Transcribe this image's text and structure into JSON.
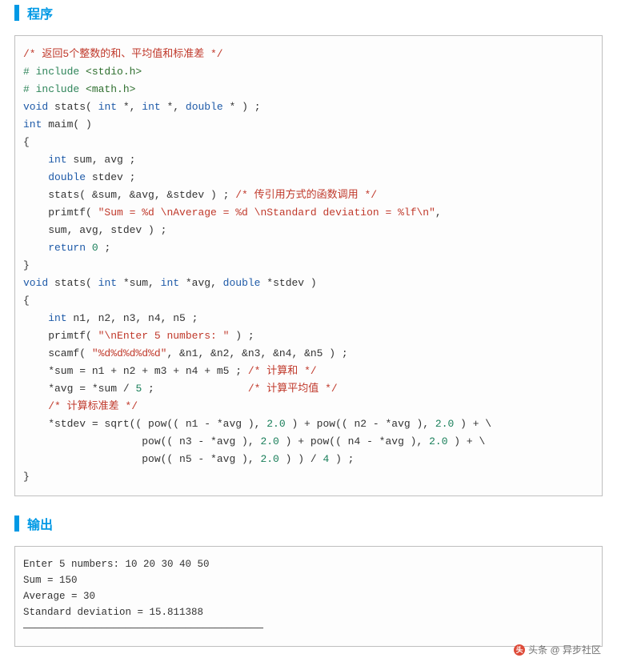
{
  "section_program": {
    "title": "程序"
  },
  "section_output": {
    "title": "输出"
  },
  "code": {
    "l1_comment": "/* 返回5个整数的和、平均值和标准差 */",
    "l2_pre": "# include ",
    "l2_inc": "<stdio.h>",
    "l3_pre": "# include ",
    "l3_inc": "<math.h>",
    "l4_a": "void",
    "l4_b": " stats( ",
    "l4_c": "int",
    "l4_d": " *, ",
    "l4_e": "int",
    "l4_f": " *, ",
    "l4_g": "double",
    "l4_h": " * ) ;",
    "l5_a": "int",
    "l5_b": " maim( )",
    "l6": "{",
    "l7_a": "    int",
    "l7_b": " sum, avg ;",
    "l8_a": "    double",
    "l8_b": " stdev ;",
    "l9_a": "    stats( &sum, &avg, &stdev ) ; ",
    "l9_b": "/* 传引用方式的函数调用 */",
    "l10_a": "    primtf( ",
    "l10_b": "\"Sum = %d \\nAverage = %d \\nStandard deviation = %lf\\n\"",
    "l10_c": ",",
    "l11": "    sum, avg, stdev ) ;",
    "l12_a": "    return ",
    "l12_b": "0",
    "l12_c": " ;",
    "l13": "}",
    "l14_a": "void",
    "l14_b": " stats( ",
    "l14_c": "int",
    "l14_d": " *sum, ",
    "l14_e": "int",
    "l14_f": " *avg, ",
    "l14_g": "double",
    "l14_h": " *stdev )",
    "l15": "{",
    "l16_a": "    int",
    "l16_b": " n1, n2, n3, n4, n5 ;",
    "l17_a": "    primtf( ",
    "l17_b": "\"\\nEnter 5 numbers: \"",
    "l17_c": " ) ;",
    "l18_a": "    scamf( ",
    "l18_b": "\"%d%d%d%d%d\"",
    "l18_c": ", &n1, &n2, &n3, &n4, &n5 ) ;",
    "l19_a": "    *sum = n1 + n2 + m3 + n4 + m5 ; ",
    "l19_b": "/* 计算和 */",
    "l20_a": "    *avg = *sum / ",
    "l20_b": "5",
    "l20_c": " ;               ",
    "l20_d": "/* 计算平均值 */",
    "l21": "    /* 计算标准差 */",
    "l22_a": "    *stdev = sqrt(( pow(( n1 - *avg ), ",
    "l22_b": "2.0",
    "l22_c": " ) + pow(( n2 - *avg ), ",
    "l22_d": "2.0",
    "l22_e": " ) + \\",
    "l23_a": "                   pow(( n3 - *avg ), ",
    "l23_b": "2.0",
    "l23_c": " ) + pow(( n4 - *avg ), ",
    "l23_d": "2.0",
    "l23_e": " ) + \\",
    "l24_a": "                   pow(( n5 - *avg ), ",
    "l24_b": "2.0",
    "l24_c": " ) ) / ",
    "l24_d": "4",
    "l24_e": " ) ;",
    "l25": "}"
  },
  "output": {
    "line1": "Enter 5 numbers: 10 20 30 40 50",
    "line2": "Sum = 150",
    "line3": "Average = 30",
    "line4": "Standard deviation = 15.811388",
    "line5": "————————————————————————————————————————"
  },
  "watermark": {
    "text": "头条 @ 异步社区"
  }
}
